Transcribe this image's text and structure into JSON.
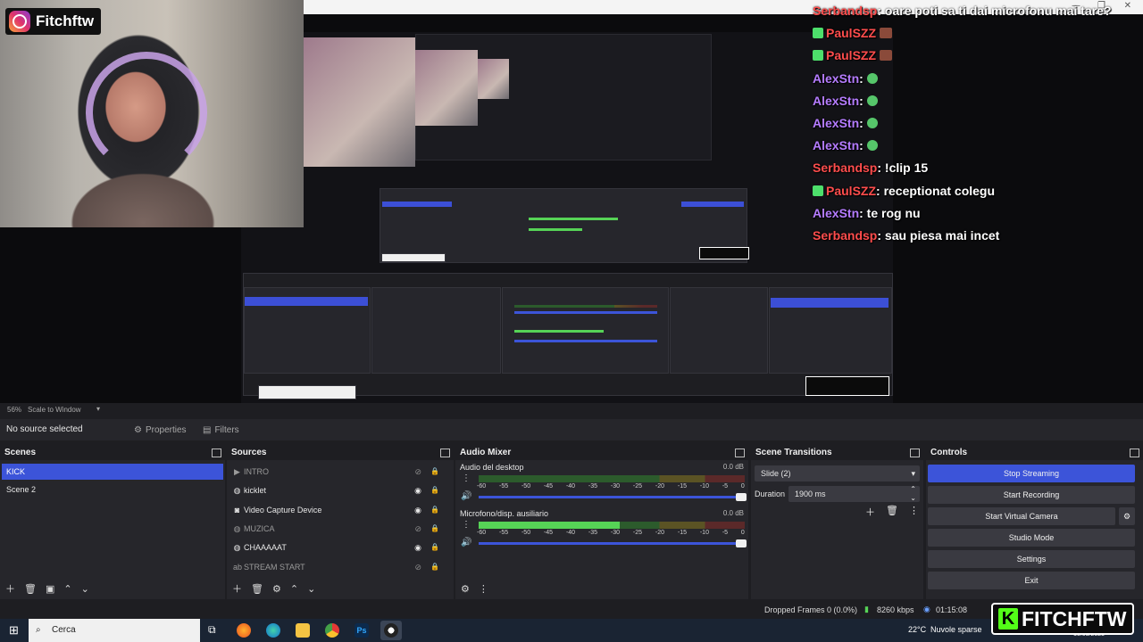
{
  "overlay": {
    "channel_name": "Fitchftw",
    "chat": [
      {
        "user": "Serbandsp",
        "color": "red",
        "badges": false,
        "text": ": oare poti sa ti dai microfonu mai tare?",
        "emote": ""
      },
      {
        "user": "PaulSZZ",
        "color": "red",
        "badges": true,
        "text": "",
        "emote": "brown"
      },
      {
        "user": "PaulSZZ",
        "color": "red",
        "badges": true,
        "text": "",
        "emote": "brown"
      },
      {
        "user": "AlexStn",
        "color": "purple",
        "badges": false,
        "text": ":",
        "emote": "green"
      },
      {
        "user": "AlexStn",
        "color": "purple",
        "badges": false,
        "text": ":",
        "emote": "green"
      },
      {
        "user": "AlexStn",
        "color": "purple",
        "badges": false,
        "text": ":",
        "emote": "green"
      },
      {
        "user": "AlexStn",
        "color": "purple",
        "badges": false,
        "text": ":",
        "emote": "green"
      },
      {
        "user": "Serbandsp",
        "color": "red",
        "badges": false,
        "text": ": !clip 15",
        "emote": ""
      },
      {
        "user": "PaulSZZ",
        "color": "red",
        "badges": true,
        "text": ": receptionat colegu",
        "emote": ""
      },
      {
        "user": "AlexStn",
        "color": "purple",
        "badges": false,
        "text": ": te rog nu",
        "emote": ""
      },
      {
        "user": "Serbandsp",
        "color": "red",
        "badges": false,
        "text": ": sau piesa mai incet",
        "emote": ""
      }
    ],
    "kick_logo_text": "FITCHFTW"
  },
  "preview_bar": {
    "zoom": "56%",
    "scale_label": "Scale to Window"
  },
  "properties_bar": {
    "no_source": "No source selected",
    "properties_label": "Properties",
    "filters_label": "Filters"
  },
  "scenes": {
    "title": "Scenes",
    "items": [
      "KICK",
      "Scene 2"
    ],
    "selected": 0
  },
  "sources": {
    "title": "Sources",
    "items": [
      {
        "name": "INTRO",
        "icon": "play-icon",
        "visible": false
      },
      {
        "name": "kicklet",
        "icon": "browser-icon",
        "visible": true
      },
      {
        "name": "Video Capture Device",
        "icon": "camera-icon",
        "visible": true
      },
      {
        "name": "MUZICA",
        "icon": "browser-icon",
        "visible": false
      },
      {
        "name": "CHAAAAAT",
        "icon": "browser-icon",
        "visible": true
      },
      {
        "name": "STREAM START",
        "icon": "text-icon",
        "visible": false
      }
    ]
  },
  "audio_mixer": {
    "title": "Audio Mixer",
    "scale": [
      "-60",
      "-55",
      "-50",
      "-45",
      "-40",
      "-35",
      "-30",
      "-25",
      "-20",
      "-15",
      "-10",
      "-5",
      "0"
    ],
    "channels": [
      {
        "name": "Audio del desktop",
        "db": "0.0 dB",
        "level": 0
      },
      {
        "name": "Microfono/disp. ausiliario",
        "db": "0.0 dB",
        "level": 0.53
      }
    ]
  },
  "scene_transitions": {
    "title": "Scene Transitions",
    "transition": "Slide (2)",
    "duration_label": "Duration",
    "duration_value": "1900 ms"
  },
  "controls": {
    "title": "Controls",
    "buttons": [
      "Stop Streaming",
      "Start Recording",
      "Start Virtual Camera",
      "Studio Mode",
      "Settings",
      "Exit"
    ]
  },
  "status": {
    "dropped_frames": "Dropped Frames 0 (0.0%)",
    "bitrate": "8260 kbps",
    "time": "01:15:08"
  },
  "taskbar": {
    "search_placeholder": "Cerca",
    "temperature": "22°C",
    "weather": "Nuvole sparse",
    "date": "10/08/2025"
  },
  "colors": {
    "accent": "#3c54d9",
    "kick_green": "#53fc18",
    "chat_red": "#ff4d4d",
    "chat_purple": "#b57cff"
  }
}
